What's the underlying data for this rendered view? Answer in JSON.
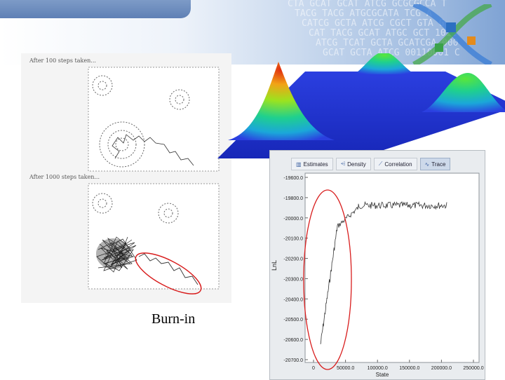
{
  "banner": {
    "dna_rows": [
      "CTA GCAT GCAT ATCG GCGCGCCA  T",
      "TACG TACG ATGCGCATA  TCG A",
      "CATCG GCTA ATCG CGCT GTA G",
      "CAT TACG GCAT ATGC GCT 1011",
      "ATCG TCAT GCTA GCATCGA 000",
      "GCAT GCTA ATCG 00110001 C"
    ]
  },
  "walk": {
    "top_caption": "After 100 steps taken...",
    "bottom_caption": "After 1000 steps taken..."
  },
  "burn_in_label": "Burn-in",
  "trace": {
    "tabs": [
      "Estimates",
      "Density",
      "Correlation",
      "Trace"
    ],
    "active_tab": "Trace",
    "ylabel": "LnL",
    "xlabel": "State",
    "yticks": [
      "-19600.0",
      "-19800.0",
      "-20000.0",
      "-20100.0",
      "-20200.0",
      "-20300.0",
      "-20400.0",
      "-20500.0",
      "-20600.0",
      "-20700.0"
    ],
    "xticks": [
      "0",
      "50000.0",
      "100000.0",
      "150000.0",
      "200000.0",
      "250000.0"
    ]
  },
  "colors": {
    "highlight": "#d81c1c",
    "surface_low": "#1f2fd0",
    "peak_high": "#e02a10"
  }
}
